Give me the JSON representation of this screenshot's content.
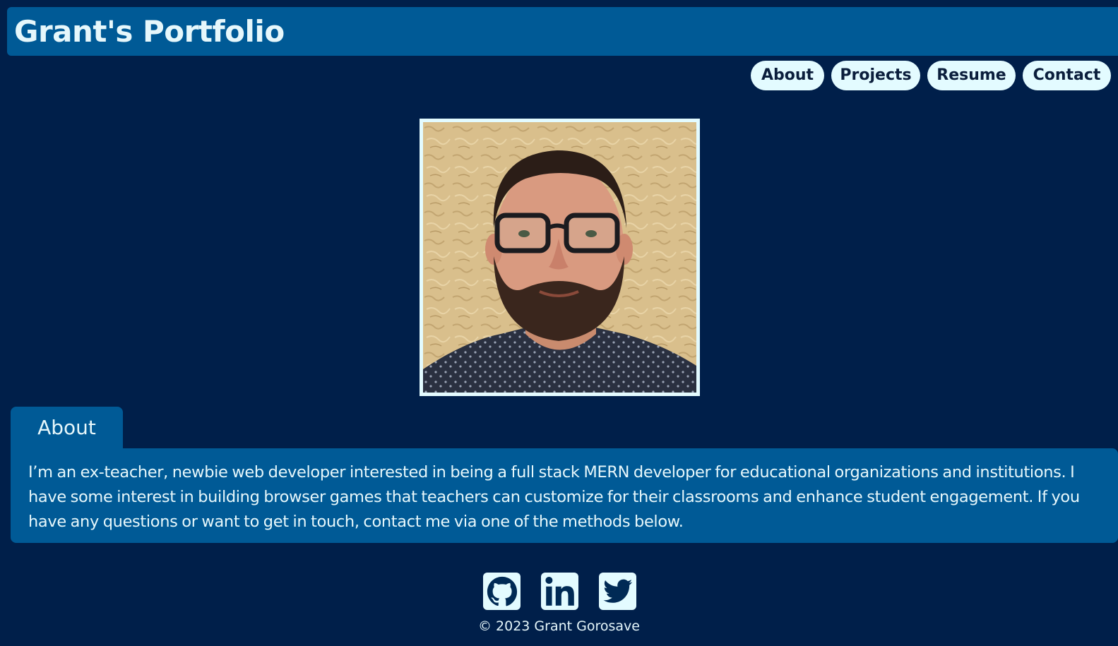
{
  "header": {
    "title": "Grant's Portfolio"
  },
  "nav": {
    "items": [
      {
        "label": "About"
      },
      {
        "label": "Projects"
      },
      {
        "label": "Resume"
      },
      {
        "label": "Contact"
      }
    ]
  },
  "profile": {
    "photo_description_icon": "profile-photo"
  },
  "about": {
    "tab_label": "About",
    "text": "I’m an ex-teacher, newbie web developer interested in being a full stack MERN developer for educational organizations and institutions. I have some interest in building browser games that teachers can customize for their classrooms and enhance student engagement. If you have any questions or want to get in touch, contact me via one of the methods below."
  },
  "social": {
    "icons": [
      "github-icon",
      "linkedin-icon",
      "twitter-icon"
    ]
  },
  "footer": {
    "copyright": "© 2023 Grant Gorosave"
  },
  "colors": {
    "background": "#001f4a",
    "panel": "#005a96",
    "accent_light": "#e3fbff",
    "text": "#e6f7fb"
  }
}
